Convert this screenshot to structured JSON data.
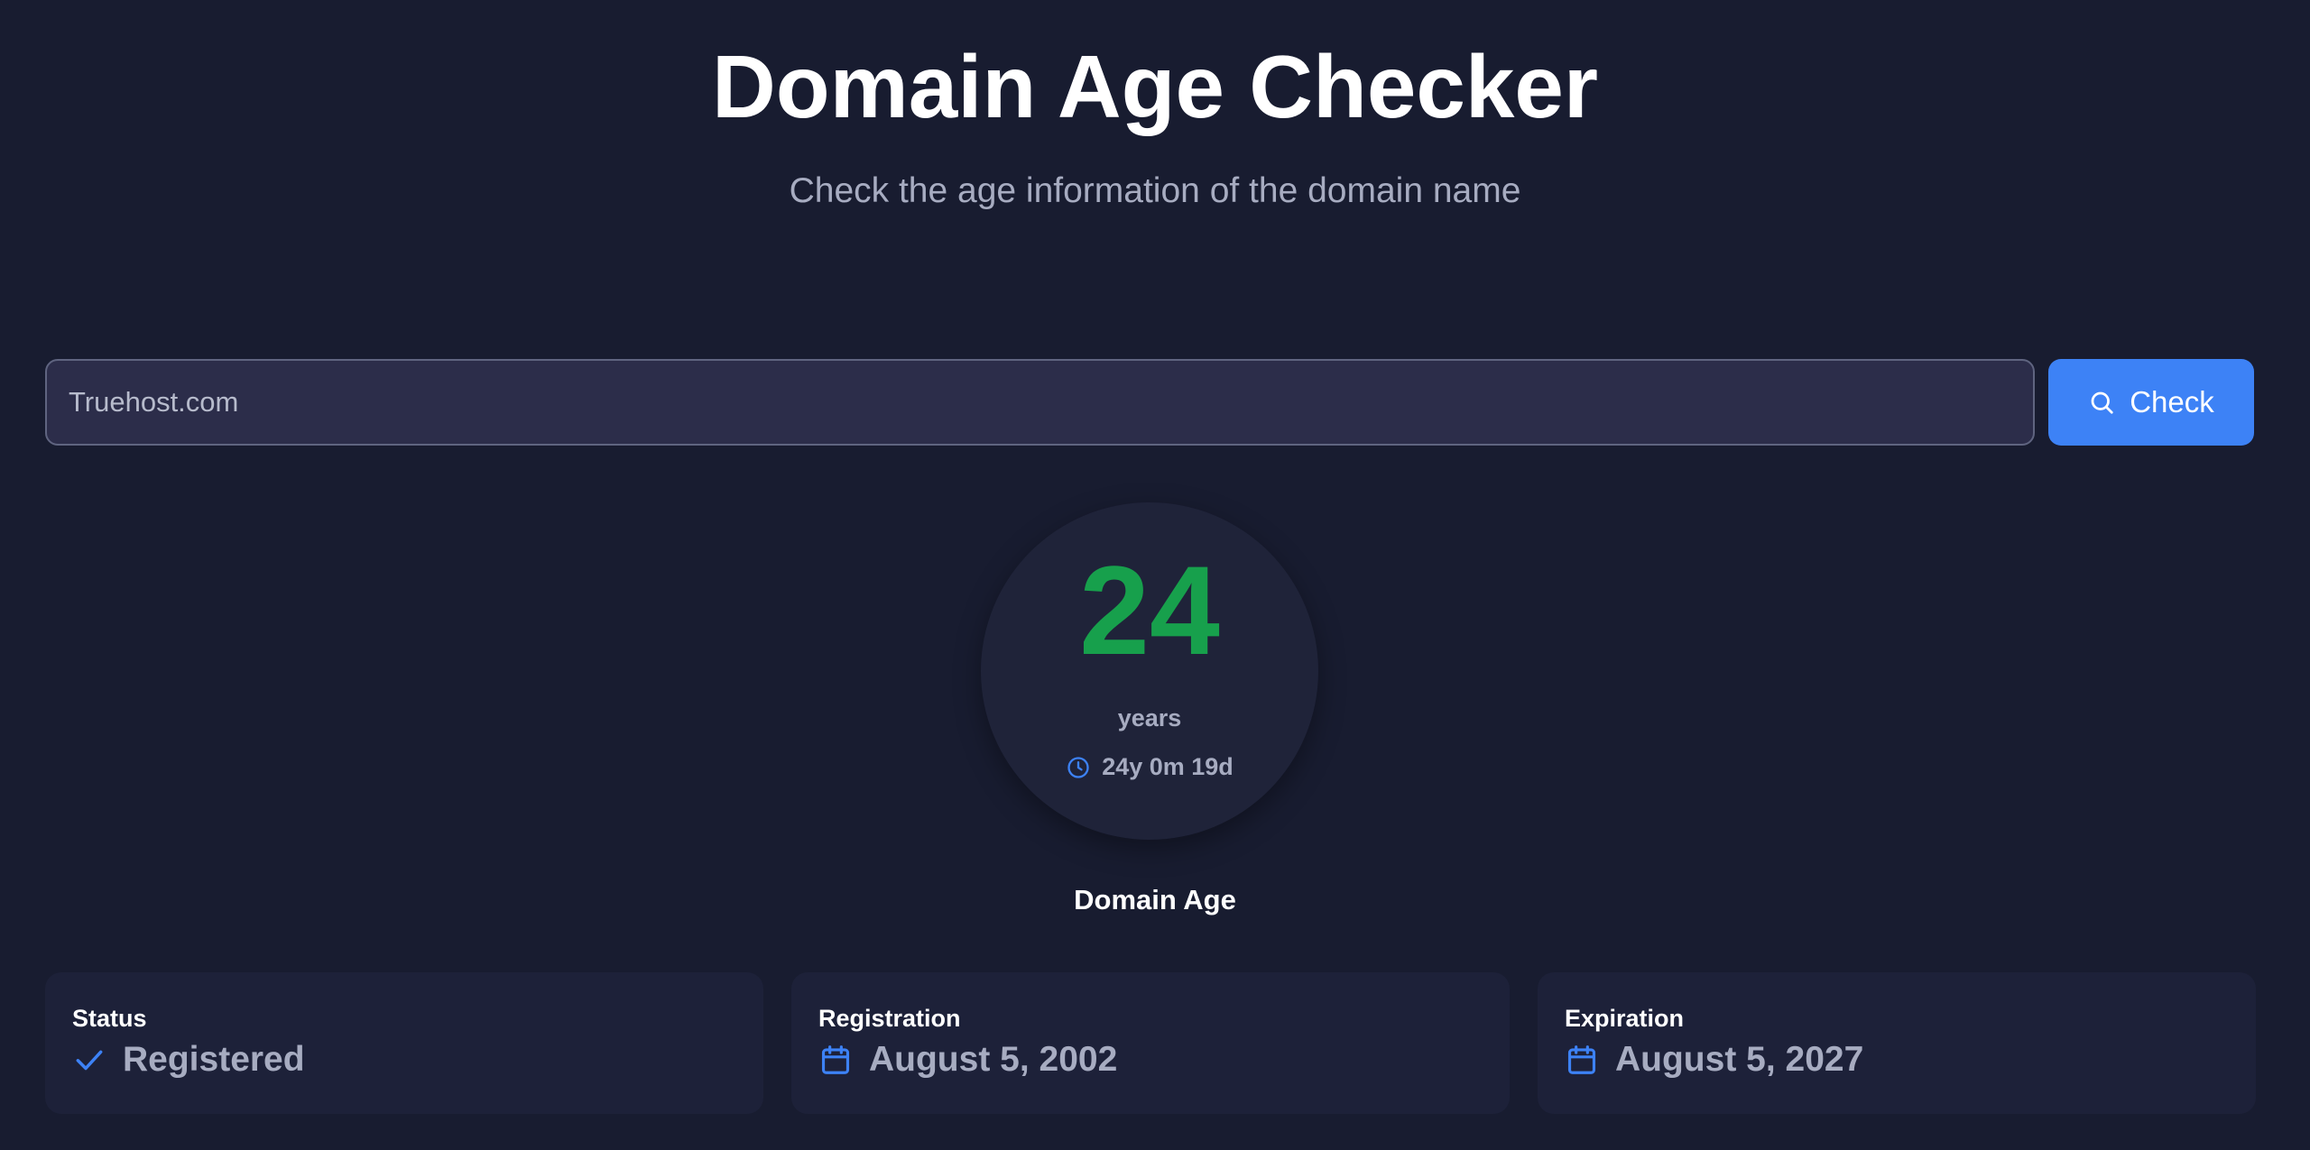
{
  "header": {
    "title": "Domain Age Checker",
    "subtitle": "Check the age information of the domain name"
  },
  "search": {
    "value": "Truehost.com",
    "placeholder": "Truehost.com",
    "button_label": "Check",
    "button_icon": "search-icon"
  },
  "age": {
    "years": "24",
    "unit": "years",
    "detail": "24y 0m 19d",
    "detail_icon": "clock-icon",
    "caption": "Domain Age"
  },
  "cards": [
    {
      "label": "Status",
      "value": "Registered",
      "icon": "check-icon"
    },
    {
      "label": "Registration",
      "value": "August 5, 2002",
      "icon": "calendar-icon"
    },
    {
      "label": "Expiration",
      "value": "August 5, 2027",
      "icon": "calendar-icon"
    }
  ],
  "colors": {
    "background": "#181c30",
    "accent": "#3d82f6",
    "age_number": "#17a04c",
    "muted_text": "#a7acc1",
    "card_background": "#1d2139"
  }
}
